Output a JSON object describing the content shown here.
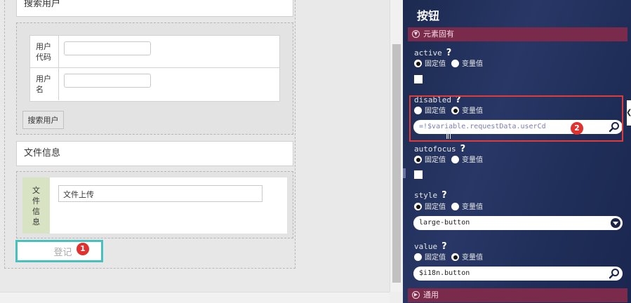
{
  "designer": {
    "search_panel_title": "搜索用户",
    "user_code_label": "用户代码",
    "user_code_value": "",
    "user_name_label": "用户名",
    "user_name_value": "",
    "search_button": "搜索用户",
    "file_panel_title": "文件信息",
    "file_label": "文件信息",
    "file_input_value": "文件上传",
    "submit_button": "登记",
    "marker_1": "1"
  },
  "properties": {
    "title": "按钮",
    "section_inherent": "元素固有",
    "section_common": "通用",
    "help_icon_text": "?",
    "fixed_value": "固定值",
    "variable_value": "变量值",
    "marker_2": "2",
    "items": [
      {
        "name": "active",
        "mode": "fixed",
        "checked": false
      },
      {
        "name": "disabled",
        "mode": "variable",
        "value": "=!$variable.requestData.userCd"
      },
      {
        "name": "autofocus",
        "mode": "fixed",
        "checked": false
      },
      {
        "name": "style",
        "mode": "fixed",
        "value": "large-button"
      },
      {
        "name": "value",
        "mode": "variable",
        "value": "$i18n.button"
      }
    ]
  },
  "colors": {
    "panel_background": "#1e2d55",
    "section_bar": "#7a2a4a",
    "highlight_red": "#e03a3a",
    "selected_button_border": "#46c1bd",
    "marker_red": "#e0312f",
    "file_label_bg": "#d8e3c4"
  }
}
